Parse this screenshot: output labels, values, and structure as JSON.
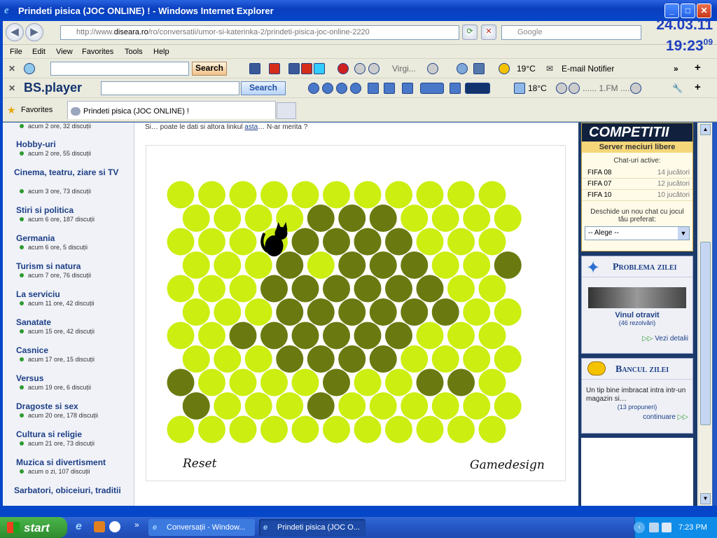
{
  "window": {
    "title": "Prindeti pisica (JOC ONLINE) ! - Windows Internet Explorer"
  },
  "clock": {
    "date": "24.03.11",
    "time": "19:23",
    "seconds": "09"
  },
  "address": {
    "url_prefix": "http://www.",
    "host": "diseara.ro",
    "path": "/ro/conversatii/umor-si-katerinka-2/prindeti-pisica-joc-online-2220",
    "search_placeholder": "Google"
  },
  "menu": [
    "File",
    "Edit",
    "View",
    "Favorites",
    "Tools",
    "Help"
  ],
  "toolbar1": {
    "search_label": "Search",
    "media_label": "Virgi...",
    "temp": "19°C",
    "email": "E-mail Notifier"
  },
  "toolbar2": {
    "brand": "BS.player",
    "search_label": "Search",
    "temp": "18°C",
    "radio": "...... 1.FM ...."
  },
  "tabs": {
    "favorites": "Favorites",
    "active_tab": "Prindeti pisica (JOC ONLINE) !"
  },
  "sidebar": {
    "top_sub": "acum 2 ore, 32 discuții",
    "items": [
      {
        "label": "Hobby-uri",
        "sub": "acum 2 ore, 55 discuții"
      },
      {
        "label": "Cinema, teatru, ziare si TV",
        "sub": "acum 3 ore, 73 discuții"
      },
      {
        "label": "Stiri si politica",
        "sub": "acum 6 ore, 187 discuții"
      },
      {
        "label": "Germania",
        "sub": "acum 6 ore, 5 discuții"
      },
      {
        "label": "Turism si natura",
        "sub": "acum 7 ore, 76 discuții"
      },
      {
        "label": "La serviciu",
        "sub": "acum 11 ore, 42 discuții"
      },
      {
        "label": "Sanatate",
        "sub": "acum 15 ore, 42 discuții"
      },
      {
        "label": "Casnice",
        "sub": "acum 17 ore, 15 discuții"
      },
      {
        "label": "Versus",
        "sub": "acum 19 ore, 6 discuții"
      },
      {
        "label": "Dragoste si sex",
        "sub": "acum 20 ore, 178 discuții"
      },
      {
        "label": "Cultura si religie",
        "sub": "acum 21 ore, 73 discuții"
      },
      {
        "label": "Muzica si divertisment",
        "sub": "acum o zi, 107 discuții"
      },
      {
        "label": "Sarbatori, obiceiuri, traditii",
        "sub": ""
      }
    ]
  },
  "main": {
    "intro_before": "Si… poate le dati si altora linkul ",
    "intro_link": "asta",
    "intro_after": "… N-ar merita ?",
    "reset_label": "Reset",
    "credit_label": "Gamedesign",
    "grid": {
      "rows": 11,
      "cols": 11,
      "light_color": "#ccee11",
      "dark_color": "#6b7a10",
      "dark": [
        [
          1,
          4
        ],
        [
          1,
          5
        ],
        [
          1,
          6
        ],
        [
          2,
          4
        ],
        [
          2,
          5
        ],
        [
          2,
          6
        ],
        [
          2,
          7
        ],
        [
          3,
          3
        ],
        [
          3,
          5
        ],
        [
          3,
          6
        ],
        [
          3,
          7
        ],
        [
          3,
          10
        ],
        [
          4,
          3
        ],
        [
          4,
          4
        ],
        [
          4,
          5
        ],
        [
          4,
          6
        ],
        [
          4,
          7
        ],
        [
          4,
          8
        ],
        [
          5,
          3
        ],
        [
          5,
          4
        ],
        [
          5,
          5
        ],
        [
          5,
          6
        ],
        [
          5,
          7
        ],
        [
          5,
          8
        ],
        [
          6,
          2
        ],
        [
          6,
          3
        ],
        [
          6,
          4
        ],
        [
          6,
          5
        ],
        [
          6,
          6
        ],
        [
          6,
          7
        ],
        [
          7,
          3
        ],
        [
          7,
          4
        ],
        [
          7,
          5
        ],
        [
          7,
          6
        ],
        [
          8,
          0
        ],
        [
          8,
          5
        ],
        [
          8,
          8
        ],
        [
          8,
          9
        ],
        [
          9,
          0
        ],
        [
          9,
          4
        ]
      ],
      "cat": [
        2,
        3
      ]
    }
  },
  "right": {
    "competitii": "COMPETITII",
    "server": "Server meciuri libere",
    "chats_title": "Chat-uri active:",
    "chats": [
      {
        "name": "FIFA 08",
        "count": "14 jucători"
      },
      {
        "name": "FIFA 07",
        "count": "12 jucători"
      },
      {
        "name": "FIFA 10",
        "count": "10 jucători"
      }
    ],
    "open_chat": "Deschide un nou chat cu jocul tău preferat:",
    "select_value": "-- Alege --",
    "problema_title": "Problema zilei",
    "problema_name": "Vinul otravit",
    "problema_count": "(46 rezolvări)",
    "problema_link": "Vezi detalii",
    "banc_title": "Bancul zilei",
    "banc_text": "Un tip bine imbracat intra intr-un magazin si…",
    "banc_count": "(13 propuneri)",
    "banc_link": "continuare"
  },
  "taskbar": {
    "start": "start",
    "tasks": [
      "Conversații - Window...",
      "Prindeti pisica (JOC O..."
    ],
    "time": "7:23 PM"
  }
}
